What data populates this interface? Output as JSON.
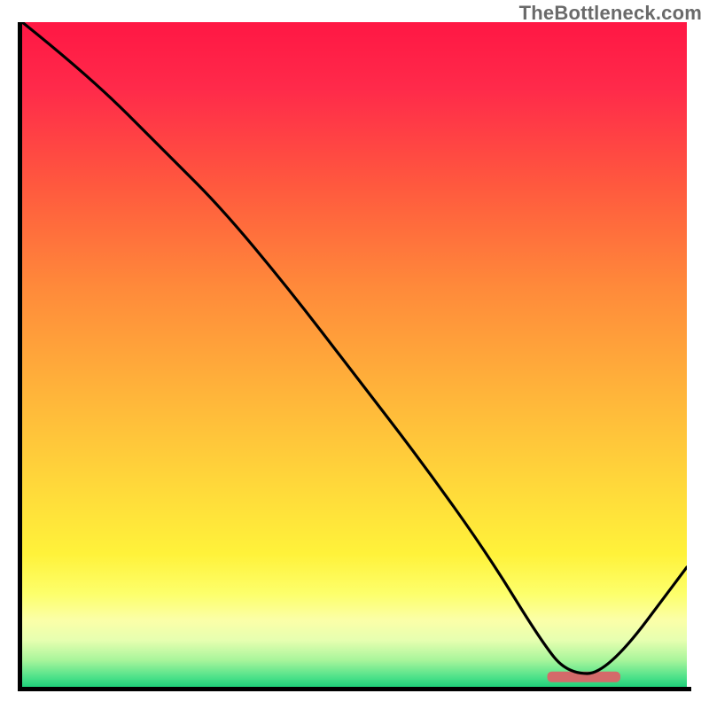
{
  "watermark": "TheBottleneck.com",
  "chart_data": {
    "type": "line",
    "title": "",
    "xlabel": "",
    "ylabel": "",
    "xlim": [
      0,
      100
    ],
    "ylim": [
      0,
      100
    ],
    "grid": false,
    "legend": false,
    "series": [
      {
        "name": "curve",
        "x": [
          0,
          10,
          22,
          30,
          40,
          50,
          60,
          70,
          78,
          82,
          88,
          100
        ],
        "y": [
          100,
          92,
          80,
          72,
          60,
          47,
          34,
          20,
          7,
          2,
          2,
          18
        ],
        "color": "#000000"
      }
    ],
    "marker": {
      "name": "optimal-range",
      "x_start": 79,
      "x_end": 90,
      "y": 1.5,
      "color": "#d46a6a"
    },
    "background_gradient_stops": [
      {
        "offset": 0.0,
        "color": "#ff1744"
      },
      {
        "offset": 0.1,
        "color": "#ff2a4a"
      },
      {
        "offset": 0.25,
        "color": "#ff5a3e"
      },
      {
        "offset": 0.4,
        "color": "#ff8a3a"
      },
      {
        "offset": 0.55,
        "color": "#ffb23a"
      },
      {
        "offset": 0.7,
        "color": "#ffd93a"
      },
      {
        "offset": 0.8,
        "color": "#fff23a"
      },
      {
        "offset": 0.86,
        "color": "#fdff6b"
      },
      {
        "offset": 0.9,
        "color": "#fbffa8"
      },
      {
        "offset": 0.93,
        "color": "#e6ffb0"
      },
      {
        "offset": 0.96,
        "color": "#a8f59b"
      },
      {
        "offset": 0.985,
        "color": "#4fe28a"
      },
      {
        "offset": 1.0,
        "color": "#1fd07a"
      }
    ]
  }
}
